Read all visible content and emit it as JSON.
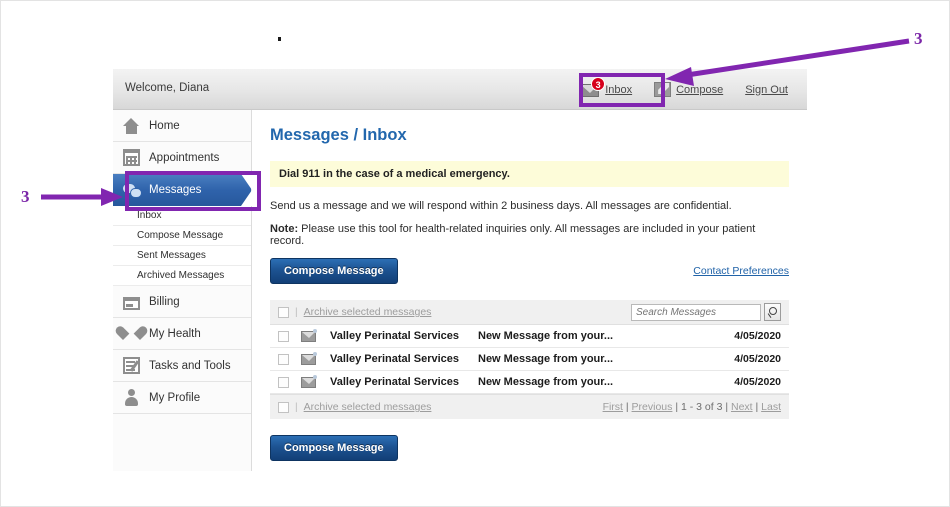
{
  "header": {
    "welcome": "Welcome, Diana",
    "nav": [
      {
        "label": "Inbox",
        "icon": "envelope-icon",
        "badge": "3"
      },
      {
        "label": "Compose",
        "icon": "pencil-icon",
        "badge": ""
      },
      {
        "label": "Sign Out",
        "icon": "",
        "badge": ""
      }
    ]
  },
  "sidebar": {
    "items": [
      {
        "label": "Home",
        "icon": "home-icon",
        "active": false
      },
      {
        "label": "Appointments",
        "icon": "calendar-icon",
        "active": false
      },
      {
        "label": "Messages",
        "icon": "speech-bubble-icon",
        "active": true
      },
      {
        "label": "Billing",
        "icon": "credit-card-icon",
        "active": false
      },
      {
        "label": "My Health",
        "icon": "heart-icon",
        "active": false
      },
      {
        "label": "Tasks and Tools",
        "icon": "clipboard-icon",
        "active": false
      },
      {
        "label": "My Profile",
        "icon": "user-icon",
        "active": false
      }
    ],
    "subitems": [
      {
        "label": "Inbox"
      },
      {
        "label": "Compose Message"
      },
      {
        "label": "Sent Messages"
      },
      {
        "label": "Archived Messages"
      }
    ]
  },
  "main": {
    "page_title": "Messages / Inbox",
    "alert": "Dial 911 in the case of a medical emergency.",
    "paragraph1": "Send us a message and we will respond within 2 business days. All messages are confidential.",
    "paragraph2_label": "Note:",
    "paragraph2_text": " Please use this tool for health-related inquiries only. All messages are included in your patient record.",
    "compose_button": "Compose Message",
    "contact_preferences_link": "Contact Preferences",
    "compose_button_bottom": "Compose Message"
  },
  "table": {
    "archive_link_top": "Archive selected messages",
    "archive_link_bottom": "Archive selected messages",
    "search_placeholder": "Search Messages",
    "search_value": "",
    "search_icon": "magnifier-icon",
    "rows": [
      {
        "from": "Valley Perinatal Services",
        "subject": "New Message from your...",
        "date": "4/05/2020"
      },
      {
        "from": "Valley Perinatal Services",
        "subject": "New Message from your...",
        "date": "4/05/2020"
      },
      {
        "from": "Valley Perinatal Services",
        "subject": "New Message from your...",
        "date": "4/05/2020"
      }
    ],
    "pager": {
      "first": "First",
      "previous": "Previous",
      "range": "1 - 3 of 3",
      "next": "Next",
      "last": "Last",
      "sep": " | "
    }
  },
  "annotations": {
    "number_left": "3",
    "number_right": "3",
    "accent_color": "#8126b0"
  }
}
